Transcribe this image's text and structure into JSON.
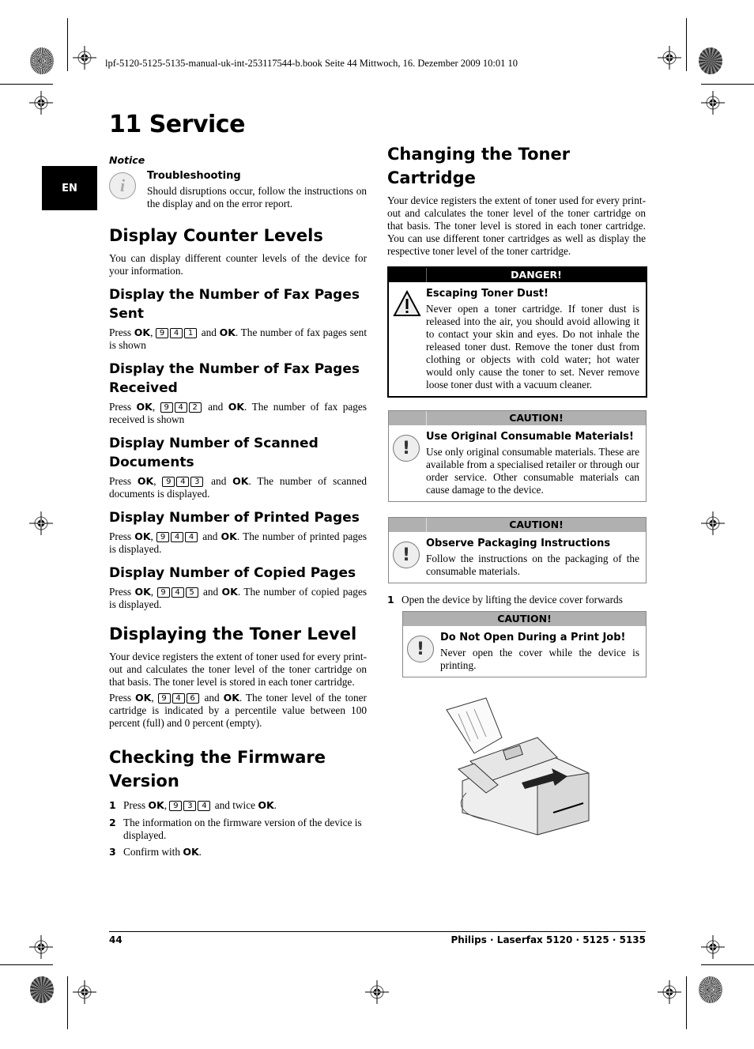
{
  "print_header": "lpf-5120-5125-5135-manual-uk-int-253117544-b.book  Seite 44  Mittwoch, 16. Dezember 2009  10:01 10",
  "language_tab": "EN",
  "chapter_title": "11 Service",
  "notice": {
    "label": "Notice",
    "icon": "info-icon",
    "title": "Troubleshooting",
    "text": "Should disruptions occur, follow the instructions on the display and on the error report."
  },
  "left": {
    "counter": {
      "heading": "Display Counter Levels",
      "intro": "You can display different counter levels of the device for your information."
    },
    "sections": [
      {
        "heading": "Display the Number of Fax Pages Sent",
        "press": "Press",
        "ok": "OK",
        "keys": [
          "9",
          "4",
          "1"
        ],
        "and": "and",
        "ok2": "OK",
        "rest": ". The number of fax pages sent is shown"
      },
      {
        "heading": "Display the Number of Fax Pages Received",
        "press": "Press",
        "ok": "OK",
        "keys": [
          "9",
          "4",
          "2"
        ],
        "and": "and",
        "ok2": "OK",
        "rest": ". The number of fax pages received is shown"
      },
      {
        "heading": "Display Number of Scanned Documents",
        "press": "Press",
        "ok": "OK",
        "keys": [
          "9",
          "4",
          "3"
        ],
        "and": "and",
        "ok2": "OK",
        "rest": ". The number of scanned documents is displayed."
      },
      {
        "heading": "Display Number of Printed Pages",
        "press": "Press",
        "ok": "OK",
        "keys": [
          "9",
          "4",
          "4"
        ],
        "and": "and",
        "ok2": "OK",
        "rest": ". The number of printed pages is displayed."
      },
      {
        "heading": "Display Number of Copied Pages",
        "press": "Press",
        "ok": "OK",
        "keys": [
          "9",
          "4",
          "5"
        ],
        "and": "and",
        "ok2": "OK",
        "rest": ". The number of copied pages is displayed."
      }
    ],
    "toner": {
      "heading": "Displaying the Toner Level",
      "text": "Your device registers the extent of toner used for every print-out and calculates the toner level of the toner cartridge on that basis. The toner level is stored in each toner cartridge.",
      "press": "Press",
      "ok": "OK",
      "keys": [
        "9",
        "4",
        "6"
      ],
      "and": "and",
      "ok2": "OK",
      "rest": ". The toner level of the toner cartridge is indicated by a percentile value between 100 percent (full) and 0 percent (empty)."
    },
    "firmware": {
      "heading": "Checking the Firmware Version",
      "steps": [
        {
          "num": "1",
          "press": "Press",
          "ok": "OK",
          "keys": [
            "9",
            "3",
            "4"
          ],
          "and": "and twice",
          "ok2": "OK",
          "rest": "."
        },
        {
          "num": "2",
          "text": "The information on the firmware version of the device is displayed."
        },
        {
          "num": "3",
          "text": "Confirm with",
          "ok": "OK",
          "rest": "."
        }
      ]
    }
  },
  "right": {
    "heading": "Changing the Toner Cartridge",
    "intro": "Your device registers the extent of toner used for every print-out and calculates the toner level of the toner cartridge on that basis. The toner level is stored in each toner cartridge. You can use different toner cartridges as well as display the respective toner level of the toner cartridge.",
    "danger": {
      "label": "DANGER!",
      "icon": "warning-triangle-icon",
      "title": "Escaping Toner Dust!",
      "text": "Never open a toner cartridge. If toner dust is released into the air, you should avoid allowing it to contact your skin and eyes. Do not inhale the released toner dust. Remove the toner dust from clothing or objects with cold water; hot water would only cause the toner to set. Never remove loose toner dust with a vacuum cleaner."
    },
    "caution1": {
      "label": "CAUTION!",
      "icon": "exclamation-icon",
      "title": "Use Original Consumable Materials!",
      "text": "Use only original consumable materials. These are available from a specialised retailer or through our order service. Other consumable materials can cause damage to the device."
    },
    "caution2": {
      "label": "CAUTION!",
      "icon": "exclamation-icon",
      "title": "Observe Packaging Instructions",
      "text": "Follow the instructions on the packaging of the consumable materials."
    },
    "step1": {
      "num": "1",
      "text": "Open the device by lifting the device cover forwards"
    },
    "caution3": {
      "label": "CAUTION!",
      "icon": "exclamation-icon",
      "title": "Do Not Open During a Print Job!",
      "text": "Never open the cover while the device is printing."
    },
    "illustration": "fax-device-cover-open-illustration"
  },
  "footer": {
    "page_number": "44",
    "title": "Philips · Laserfax 5120 · 5125 · 5135"
  }
}
